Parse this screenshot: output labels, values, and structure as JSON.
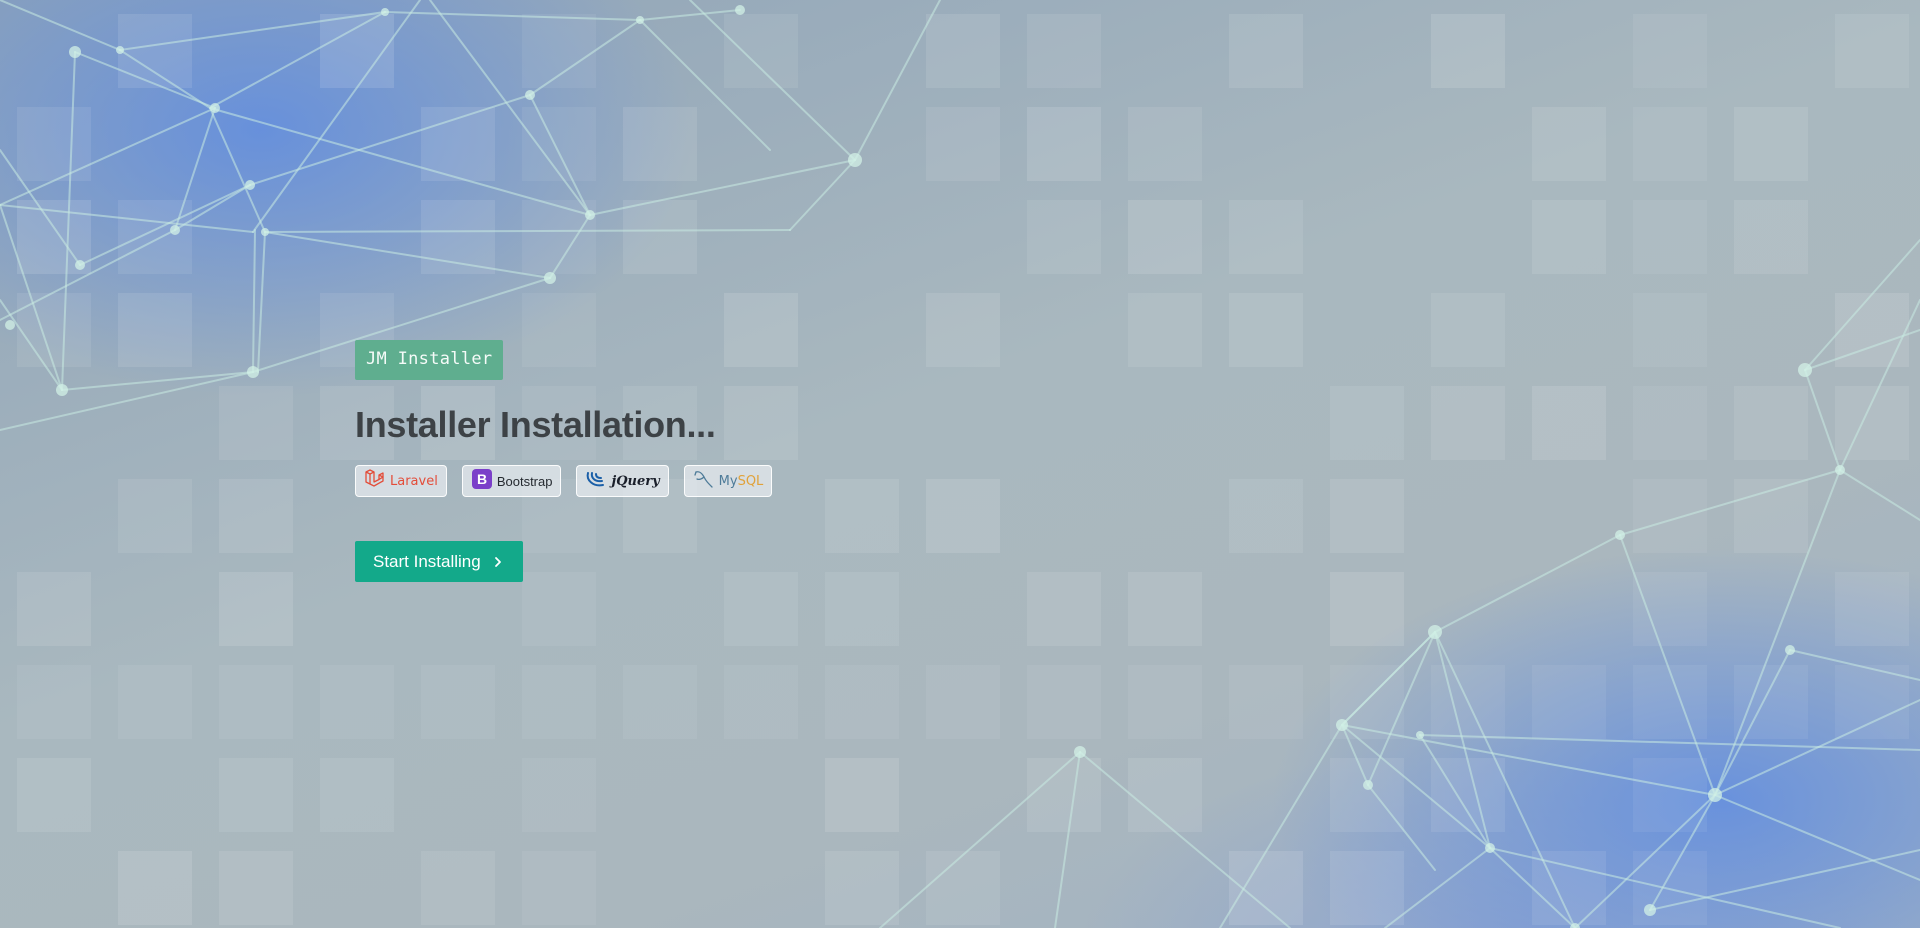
{
  "brand": {
    "name": "JM Installer",
    "color": "#5fae8f"
  },
  "heading": {
    "title": "Installer Installation..."
  },
  "tech_stack": [
    {
      "name": "Laravel",
      "icon": "laravel-logo-icon",
      "color": "#e34d3a"
    },
    {
      "name": "Bootstrap",
      "icon": "bootstrap-logo-icon",
      "color": "#7b3fc9"
    },
    {
      "name": "jQuery",
      "icon": "jquery-logo-icon",
      "color": "#1a5fa8"
    },
    {
      "name_part1": "My",
      "name_part2": "SQL",
      "icon": "mysql-dolphin-icon",
      "color": "#4f7c99"
    }
  ],
  "actions": {
    "start_label": "Start Installing",
    "start_icon": "chevron-right-icon",
    "start_color": "#13a98a"
  }
}
